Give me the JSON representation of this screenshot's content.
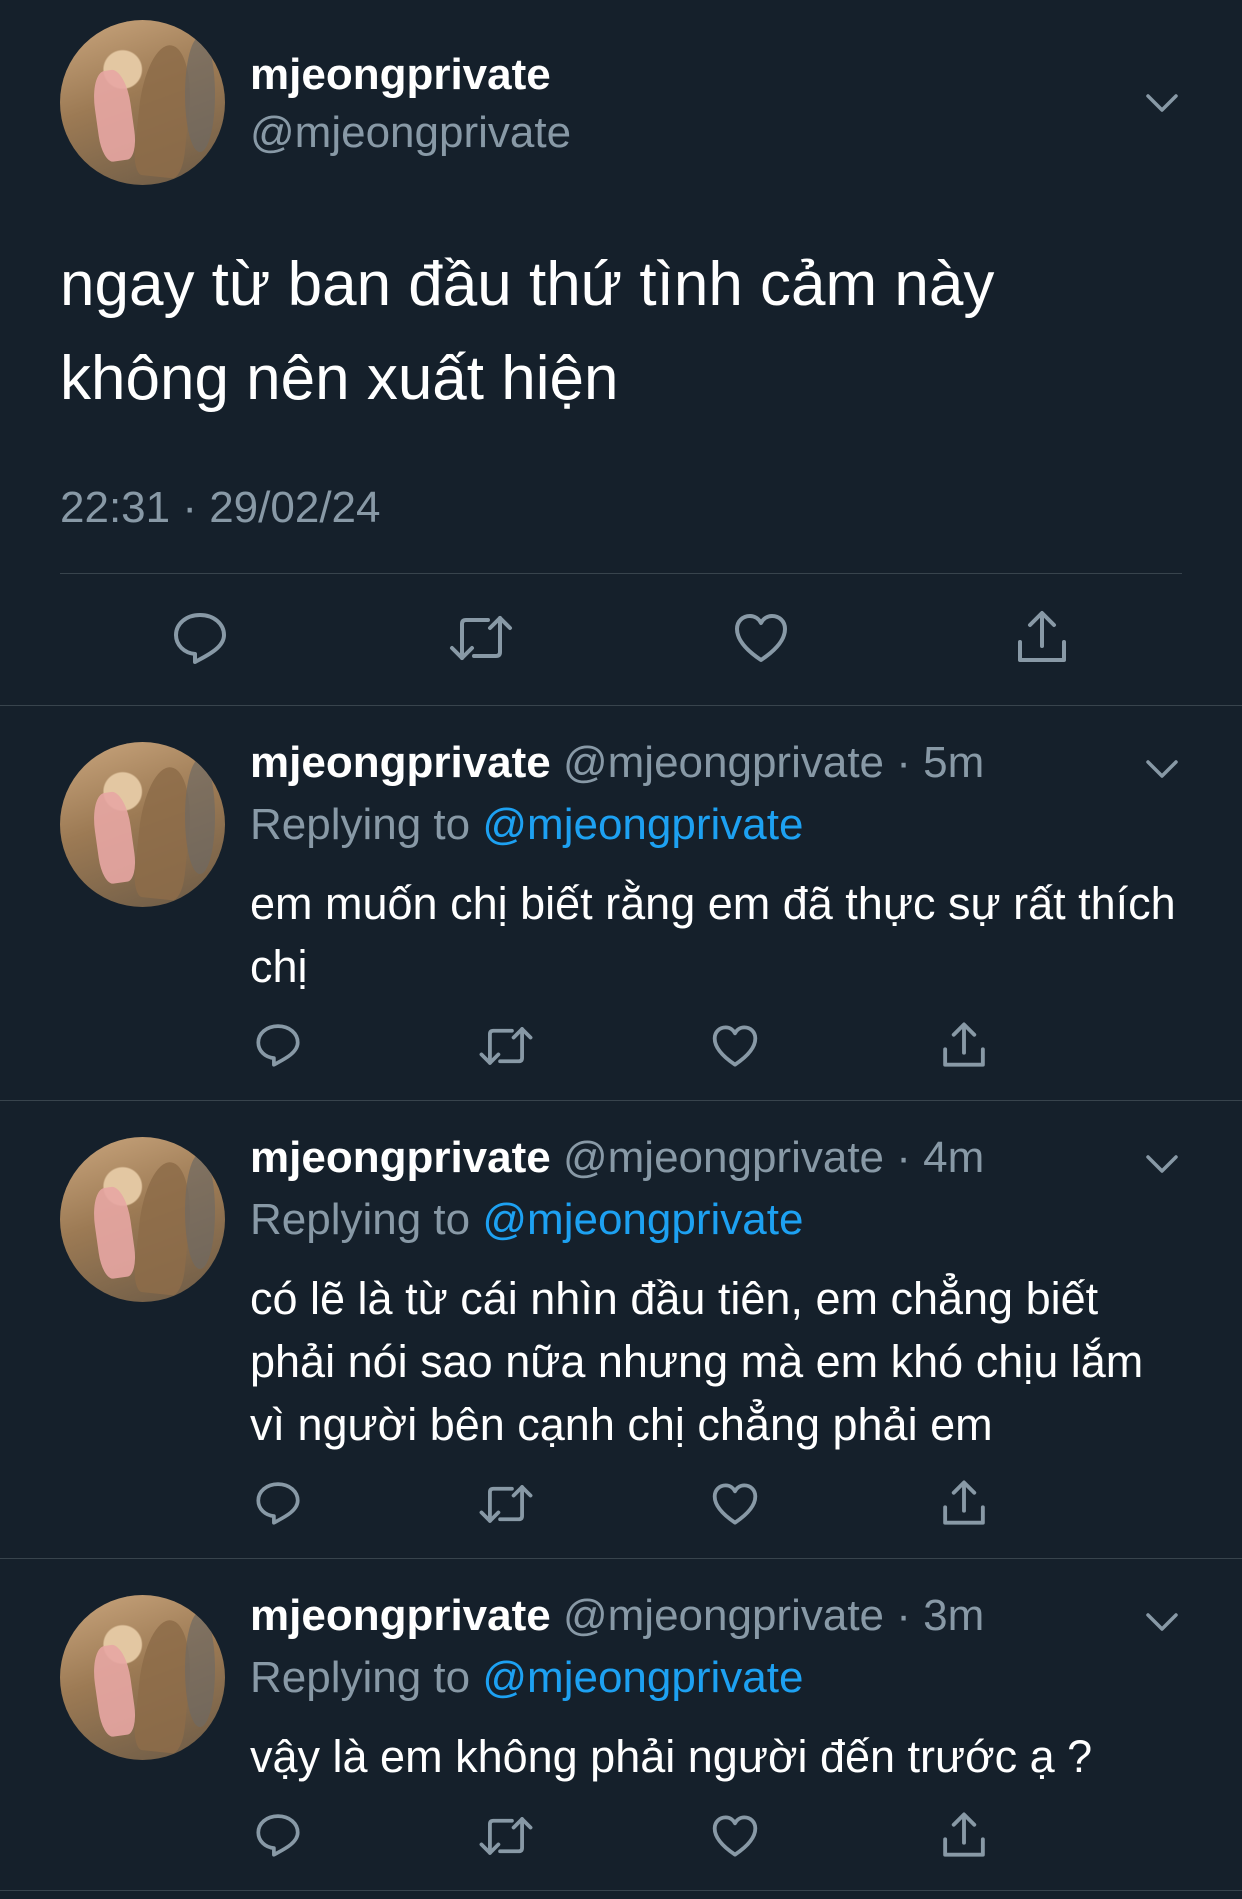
{
  "main_tweet": {
    "display_name": "mjeongprivate",
    "handle": "@mjeongprivate",
    "text": "ngay từ ban đầu thứ tình cảm này không nên xuất hiện",
    "timestamp": "22:31 · 29/02/24",
    "icons": [
      "reply-icon",
      "retweet-icon",
      "like-icon",
      "share-icon",
      "chevron-down-icon"
    ]
  },
  "replies": [
    {
      "display_name": "mjeongprivate",
      "handle": "@mjeongprivate",
      "time": "5m",
      "replying_label": "Replying to",
      "replying_to": "@mjeongprivate",
      "text": "em muốn chị biết rằng em đã thực sự rất thích chị"
    },
    {
      "display_name": "mjeongprivate",
      "handle": "@mjeongprivate",
      "time": "4m",
      "replying_label": "Replying to",
      "replying_to": "@mjeongprivate",
      "text": "có lẽ là từ cái nhìn đầu tiên, em chẳng biết phải nói sao nữa nhưng mà em khó chịu lắm vì người bên cạnh chị chẳng phải em"
    },
    {
      "display_name": "mjeongprivate",
      "handle": "@mjeongprivate",
      "time": "3m",
      "replying_label": "Replying to",
      "replying_to": "@mjeongprivate",
      "text": "vậy là em không phải người đến trước ạ ?"
    }
  ],
  "colors": {
    "background": "#15202b",
    "secondary_text": "#8899a6",
    "link": "#1da1f2",
    "divider": "#38444d"
  }
}
